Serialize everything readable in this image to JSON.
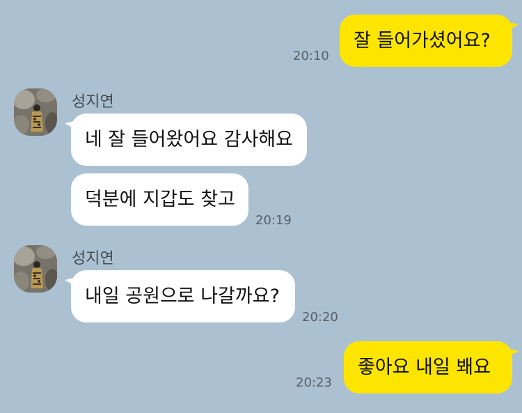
{
  "messages": [
    {
      "id": "m1",
      "from": "me",
      "text": "잘 들어가셨어요?",
      "time": "20:10"
    },
    {
      "id": "m2",
      "from": "them",
      "sender": "성지연",
      "text": "네 잘 들어왔어요 감사해요",
      "time": ""
    },
    {
      "id": "m3",
      "from": "them",
      "sender": "",
      "text": "덕분에 지갑도 찾고",
      "time": "20:19"
    },
    {
      "id": "m4",
      "from": "them",
      "sender": "성지연",
      "text": "내일 공원으로 나갈까요?",
      "time": "20:20"
    },
    {
      "id": "m5",
      "from": "me",
      "text": "좋아요 내일 봬요",
      "time": "20:23"
    }
  ],
  "contact": {
    "name": "성지연",
    "avatar_icon": "profile-photo"
  },
  "colors": {
    "background": "#abc1d1",
    "my_bubble": "#fee500",
    "their_bubble": "#ffffff"
  }
}
